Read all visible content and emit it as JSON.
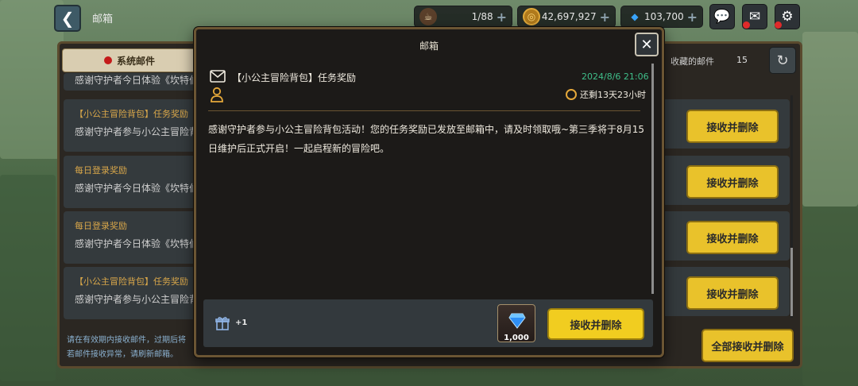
{
  "topbar": {
    "back_icon": "chevron-left-icon",
    "title": "邮箱",
    "stamina": "1/88",
    "gold": "42,697,927",
    "gems": "103,700",
    "plus": "+",
    "icons": [
      "chat-icon",
      "mail-icon",
      "gear-icon"
    ]
  },
  "panel": {
    "system_tab": "系统邮件",
    "collected_label": "收藏的邮件",
    "collected_count": "15",
    "claim_label": "接收并删除",
    "claim_all": "全部接收并删除",
    "hint_line1": "请在有效期内接收邮件，过期后将",
    "hint_line2": "若邮件接收异常，请刷新邮箱。",
    "mails": [
      {
        "title": "【小公主冒险背包】任务奖励",
        "desc": "感谢守护者参与小公主冒险背"
      },
      {
        "title": "每日登录奖励",
        "desc": "感谢守护者今日体验《坎特伯"
      },
      {
        "title": "每日登录奖励",
        "desc": "感谢守护者今日体验《坎特伯"
      },
      {
        "title": "【小公主冒险背包】任务奖励",
        "desc": "感谢守护者参与小公主冒险背"
      }
    ],
    "partial_top": "感谢守护者今日体验《坎特伯"
  },
  "modal": {
    "title": "邮箱",
    "subject": "【小公主冒险背包】任务奖励",
    "date": "2024/8/6 21:06",
    "expire": "还剩13天23小时",
    "body": "感谢守护者参与小公主冒险背包活动！您的任务奖励已发放至邮箱中，请及时领取哦~第三季将于8月15日维护后正式开启！一起启程新的冒险吧。",
    "gift_count": "+1",
    "item_count": "1,000",
    "claim": "接收并删除"
  },
  "colors": {
    "accent_yellow": "#f1cd20",
    "date_green": "#3fbf8a",
    "mail_title_orange": "#d7a64a",
    "border_brown": "#6b5533"
  }
}
